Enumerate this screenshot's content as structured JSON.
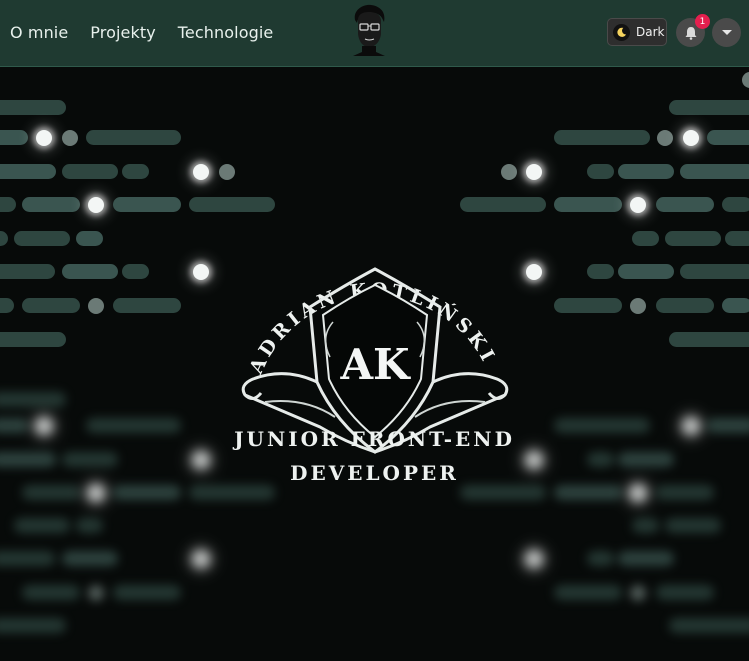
{
  "nav": {
    "items": [
      {
        "label": "O mnie"
      },
      {
        "label": "Projekty"
      },
      {
        "label": "Technologie"
      }
    ]
  },
  "header": {
    "logo_icon": "portrait-face-icon",
    "theme_toggle": {
      "label": "Dark",
      "icon": "moon-icon"
    },
    "notifications": {
      "count": "1",
      "icon": "bell-icon"
    },
    "menu": {
      "icon": "chevron-down-icon"
    }
  },
  "hero": {
    "arc_name": "ADRIAN KOTLIŃSKI",
    "monogram": "AK",
    "title_line1": "JUNIOR FRONT-END",
    "title_line2": "DEVELOPER"
  },
  "colors": {
    "header_bg": "#1f3a31",
    "hero_bg": "#070a09",
    "badge": "#e41f4e"
  }
}
